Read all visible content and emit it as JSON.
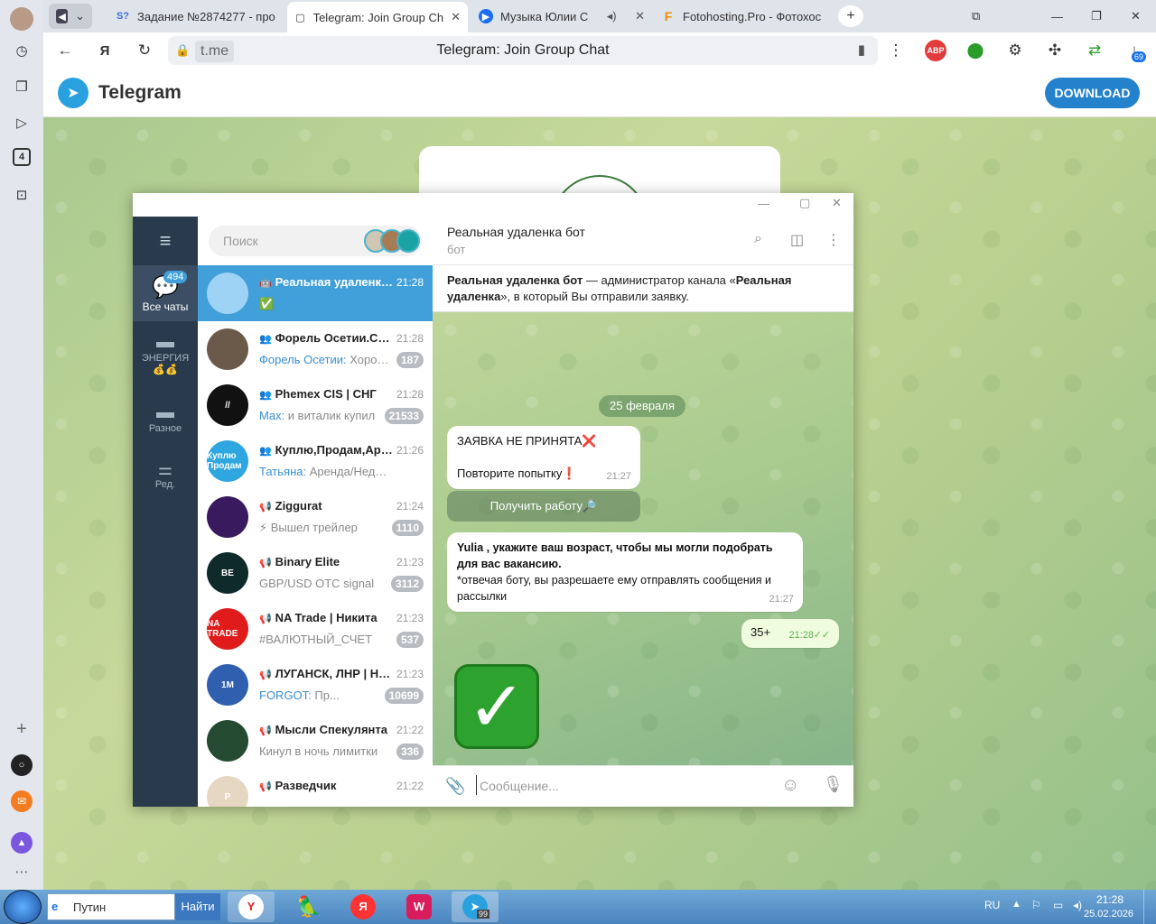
{
  "browser": {
    "tabs": [
      {
        "label": "Задание №2874277 - про",
        "fav": "S?"
      },
      {
        "label": "Telegram: Join Group Ch",
        "fav": "▢"
      },
      {
        "label": "Музыка Юлии С",
        "fav": "▶"
      },
      {
        "label": "Fotohosting.Pro - Фотохос",
        "fav": "F"
      }
    ],
    "address_host": "t.me",
    "page_title": "Telegram: Join Group Chat",
    "abp": "ABP",
    "downloads_count": "69",
    "left_badge": "4"
  },
  "tg_page": {
    "brand": "Telegram",
    "download_label": "DOWNLOAD"
  },
  "rail": {
    "all_chats_badge": "494",
    "all_chats_label": "Все чаты",
    "folder1_label": "ЭНЕРГИЯ",
    "folder1_emoji": "💰💰",
    "folder2_label": "Разное",
    "settings_label": "Ред."
  },
  "search": {
    "placeholder": "Поиск"
  },
  "chats": [
    {
      "name": "Реальная удаленка бот",
      "time": "21:28",
      "preview": "✅",
      "sender": "",
      "badge": "",
      "icon": "🤖",
      "color": "#9fd3f5",
      "avtext": ""
    },
    {
      "name": "Форель Осетии.Сотрудники",
      "time": "21:28",
      "preview": "Хорошие",
      "sender": "Форель Осетии:",
      "badge": "187",
      "icon": "👥",
      "color": "#6b5a4a",
      "avtext": ""
    },
    {
      "name": "Phemex CIS | СНГ",
      "time": "21:28",
      "preview": "и виталик купил",
      "sender": "Max:",
      "badge": "21533",
      "icon": "👥",
      "color": "#111111",
      "avtext": "//"
    },
    {
      "name": "Куплю,Продам,Аренда",
      "time": "21:26",
      "preview": "Аренда/Недвижимость",
      "sender": "Татьяна:",
      "badge": "",
      "icon": "👥",
      "color": "#2ea7e0",
      "avtext": "Куплю Продам"
    },
    {
      "name": "Ziggurat",
      "time": "21:24",
      "preview": "⚡ Вышел трейлер",
      "sender": "",
      "badge": "1110",
      "icon": "📢",
      "color": "#3a1a5e",
      "avtext": ""
    },
    {
      "name": "Binary Elite",
      "time": "21:23",
      "preview": "GBP/USD OTC signal",
      "sender": "",
      "badge": "3112",
      "icon": "📢",
      "color": "#0e2a2a",
      "avtext": "BE"
    },
    {
      "name": "NA Trade | Никита",
      "time": "21:23",
      "preview": "#ВАЛЮТНЫЙ_СЧЕТ",
      "sender": "",
      "badge": "537",
      "icon": "📢",
      "color": "#e01b1b",
      "avtext": "NA TRADE"
    },
    {
      "name": "ЛУГАНСК, ЛНР | Новости",
      "time": "21:23",
      "preview": "Пр...",
      "sender": "FORGOT:",
      "badge": "10699",
      "icon": "📢",
      "color": "#2f5fae",
      "avtext": "1M"
    },
    {
      "name": "Мысли Спекулянта",
      "time": "21:22",
      "preview": "Кинул в ночь лимитки",
      "sender": "",
      "badge": "336",
      "icon": "📢",
      "color": "#244a32",
      "avtext": ""
    },
    {
      "name": "Разведчик",
      "time": "21:22",
      "preview": "",
      "sender": "",
      "badge": "",
      "icon": "📢",
      "color": "#e6d7c3",
      "avtext": "P"
    }
  ],
  "chat": {
    "title": "Реальная удаленка бот",
    "subtitle": "бот",
    "pinned_bold1": "Реальная удаленка бот",
    "pinned_text1": " — администратор канала «",
    "pinned_bold2": "Реальная удаленка",
    "pinned_text2": "», в который Вы отправили заявку.",
    "date": "25 февраля",
    "msg1_line1": "ЗАЯВКА НЕ ПРИНЯТА❌",
    "msg1_line2": "Повторите попытку❗",
    "msg1_time": "21:27",
    "button_label": "Получить работу🔎",
    "msg2_bold": "Yulia , укажите ваш возраст, чтобы мы могли подобрать для вас вакансию.",
    "msg2_text": "*отвечая боту, вы разрешаете ему отправлять сообщения и рассылки",
    "msg2_time": "21:27",
    "out_text": "35+",
    "out_time": "21:28",
    "big_emoji": "✓",
    "composer_placeholder": "Сообщение..."
  },
  "taskbar": {
    "search_placeholder": "Путин",
    "search_button": "Найти",
    "lang": "RU",
    "time": "21:28",
    "date": "25.02.2026",
    "tg_badge": "99"
  }
}
